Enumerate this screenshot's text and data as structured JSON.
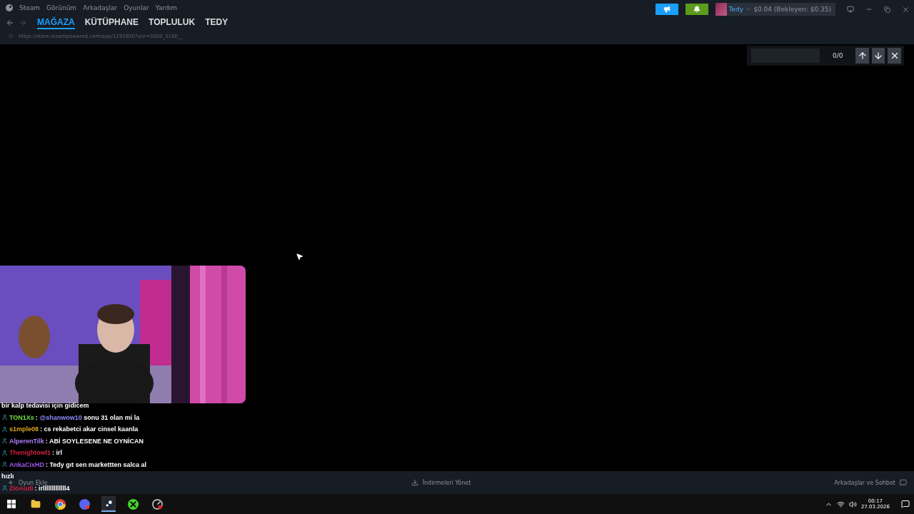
{
  "menu": [
    "Steam",
    "Görünüm",
    "Arkadaşlar",
    "Oyunlar",
    "Yardım"
  ],
  "nav_tabs": [
    {
      "label": "MAĞAZA",
      "selected": true
    },
    {
      "label": "KÜTÜPHANE",
      "selected": false
    },
    {
      "label": "TOPLULUK",
      "selected": false
    },
    {
      "label": "TEDY",
      "selected": false
    }
  ],
  "url": "https://store.steampowered.com/app/1295920?snr=5000_5100__",
  "account": {
    "name": "Tedy",
    "balance": "$0.04 (Bekleyen: $0.35)"
  },
  "find_bar": {
    "count": "0/0"
  },
  "chat": [
    {
      "kind": "continuation",
      "text": "bir kalp tedavisi için gidicem"
    },
    {
      "kind": "message",
      "user": "TON1Xs",
      "color": "#6fe04a",
      "separator": ":",
      "mention": "@shanwow10",
      "text": "sonu 31 olan mi la"
    },
    {
      "kind": "message",
      "user": "s1mple08",
      "color": "#daa520",
      "separator": ":",
      "text": "cs rekabetci akar cinsel kaanla"
    },
    {
      "kind": "message",
      "user": "AlperenTilk",
      "color": "#b07cff",
      "separator": ":",
      "text": "ABİ SOYLESENE NE OYNİCAN"
    },
    {
      "kind": "message",
      "user": "Thenightowl1",
      "color": "#d0213e",
      "separator": ":",
      "text": "irl"
    },
    {
      "kind": "message",
      "user": "AnkaCixHD",
      "color": "#9b59e6",
      "separator": ":",
      "text": "Tedy gıt sen markettten salca al"
    },
    {
      "kind": "continuation",
      "text": "hızlı"
    },
    {
      "kind": "message",
      "user": "ZioAudi",
      "color": "#d0213e",
      "separator": ":",
      "text": "irlllllllllllll4"
    }
  ],
  "bottom_bar": {
    "add_game": "Oyun Ekle",
    "downloads": "İndirmeleri Yönet",
    "friends": "Arkadaşlar ve Sohbet"
  },
  "taskbar": {
    "time": "00:17",
    "date": "27.03.2026"
  }
}
